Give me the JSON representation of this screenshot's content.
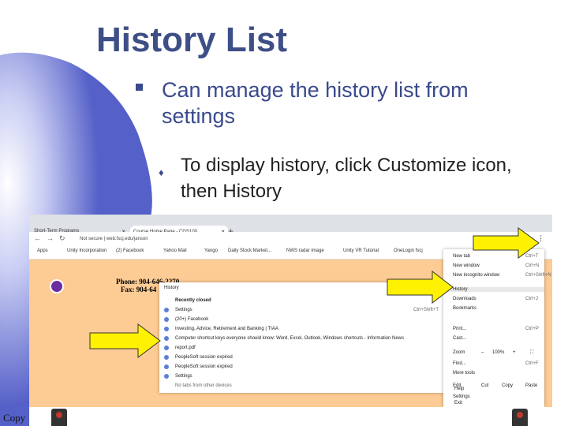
{
  "slide": {
    "title": "History List",
    "bullet1": "Can manage the history list from settings",
    "bullet2": "To display history, click Customize icon, then History",
    "copyright": "Copy"
  },
  "browser": {
    "tab1": "Short-Term Programs",
    "tab2": "Course Home Page - CGS100",
    "address": "Not secure | web.fscj.edu/janson",
    "bookmarks": [
      "Apps",
      "Unity Incorporation",
      "(2) Facebook",
      "Yahoo Mail",
      "Yango",
      "Daily Stock Market...",
      "NWS radar image",
      "Unity VR Tutorial",
      "OneLogin fscj"
    ],
    "page_phone": "Phone:  904-646-2270",
    "page_fax": "Fax:  904-64",
    "history_panel": {
      "header": "History",
      "recently_closed": "Recently closed",
      "rows": [
        {
          "label": "Settings",
          "shortcut": "Ctrl+Shift+T"
        },
        {
          "label": "(20+) Facebook",
          "shortcut": ""
        },
        {
          "label": "Investing, Advice, Retirement and Banking | TIAA",
          "shortcut": ""
        },
        {
          "label": "Computer shortcut keys everyone should know: Word, Excel, Outlook, Windows shortcuts - Information News",
          "shortcut": ""
        },
        {
          "label": "report.pdf",
          "shortcut": ""
        },
        {
          "label": "PeopleSoft session expired",
          "shortcut": ""
        },
        {
          "label": "PeopleSoft session expired",
          "shortcut": ""
        },
        {
          "label": "Settings",
          "shortcut": ""
        }
      ],
      "footer": "No tabs from other devices"
    },
    "menu": {
      "items": [
        {
          "label": "New tab",
          "shortcut": "Ctrl+T"
        },
        {
          "label": "New window",
          "shortcut": "Ctrl+N"
        },
        {
          "label": "New incognito window",
          "shortcut": "Ctrl+Shift+N"
        },
        {
          "label": "History",
          "shortcut": ""
        },
        {
          "label": "Downloads",
          "shortcut": "Ctrl+J"
        },
        {
          "label": "Bookmarks",
          "shortcut": ""
        },
        {
          "label": "Print...",
          "shortcut": "Ctrl+P"
        },
        {
          "label": "Cast...",
          "shortcut": ""
        },
        {
          "label": "Find...",
          "shortcut": "Ctrl+F"
        },
        {
          "label": "More tools",
          "shortcut": ""
        },
        {
          "label": "Settings",
          "shortcut": ""
        },
        {
          "label": "Help",
          "shortcut": ""
        },
        {
          "label": "Exit",
          "shortcut": ""
        }
      ],
      "zoom_label": "Zoom",
      "zoom_minus": "–",
      "zoom_value": "100%",
      "zoom_plus": "+",
      "zoom_fullscreen": "⛶",
      "edit_label": "Edit",
      "cut_label": "Cut",
      "copy_label": "Copy",
      "paste_label": "Paste"
    }
  },
  "colors": {
    "title": "#3d4f86",
    "accent_blue": "#3a4a8c",
    "page_bg": "#fdcb94",
    "arrow_fill": "#fff200"
  }
}
